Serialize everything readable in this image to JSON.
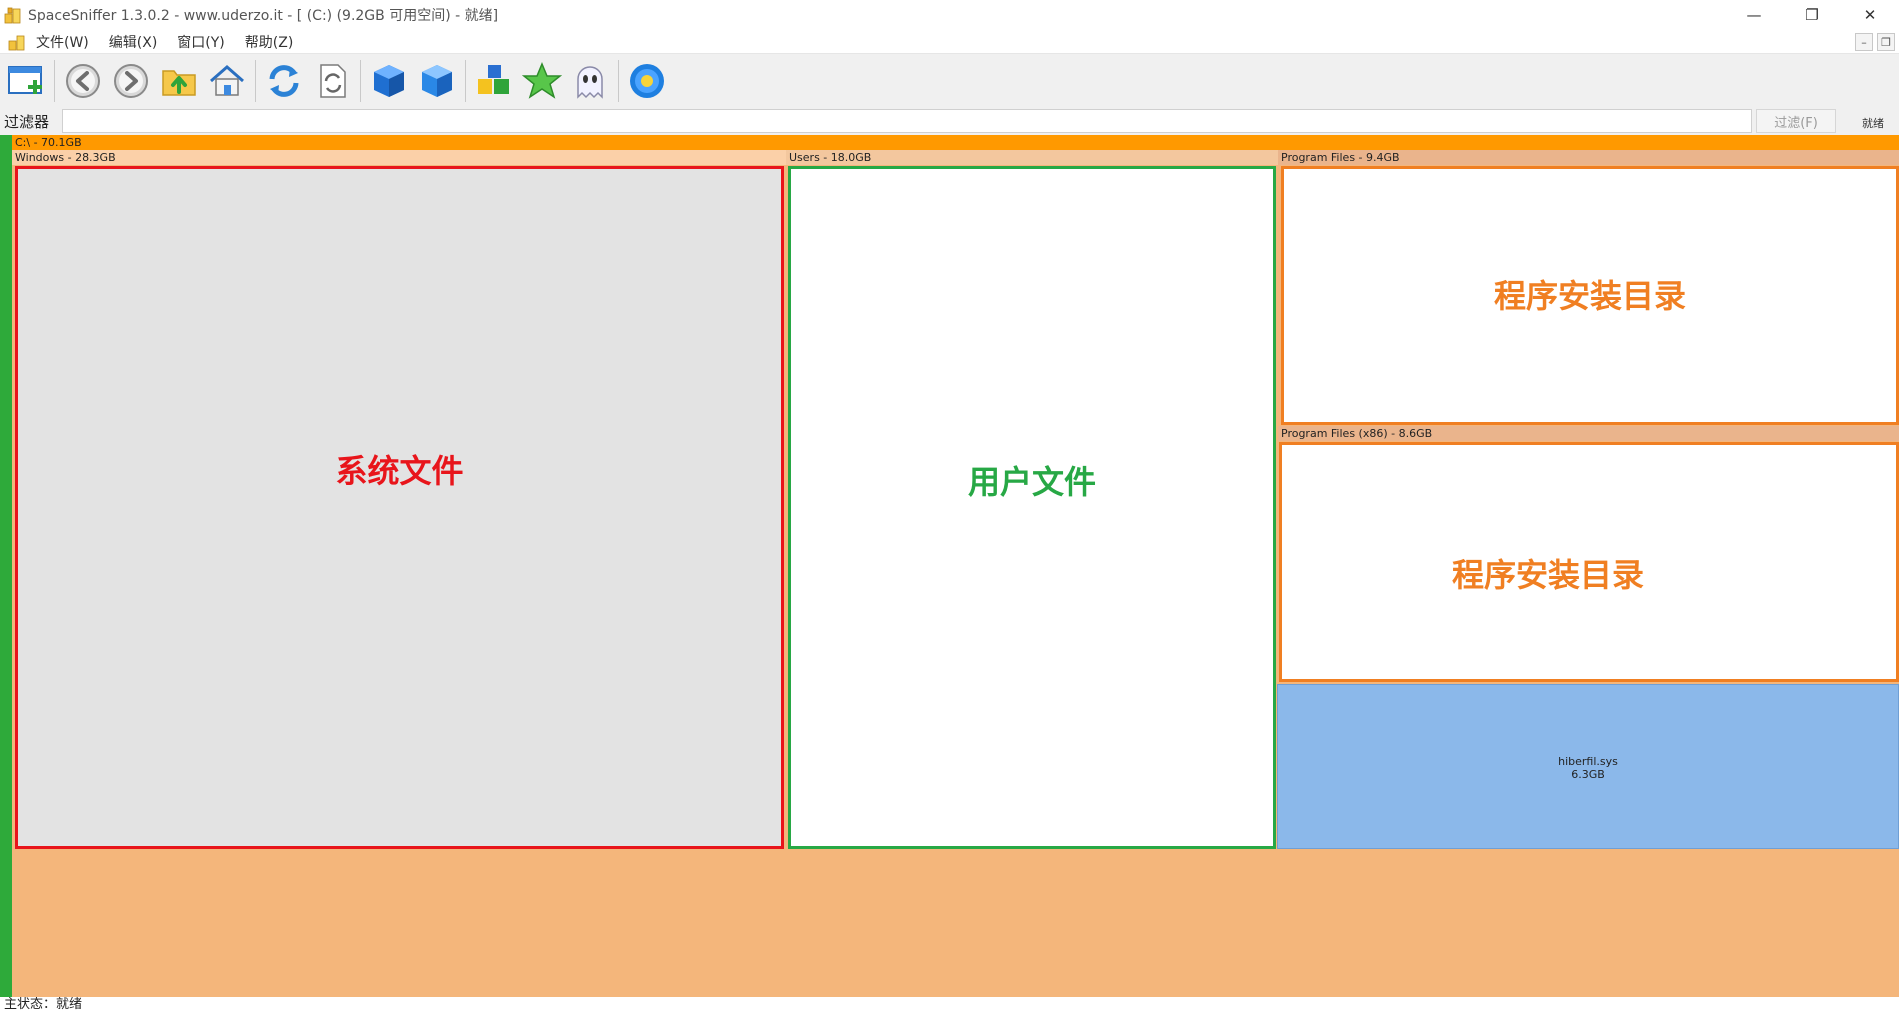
{
  "window": {
    "title": "SpaceSniffer 1.3.0.2 - www.uderzo.it - [ (C:) (9.2GB 可用空间) - 就绪]",
    "minimize": "—",
    "restore": "❐",
    "close": "✕"
  },
  "menu": {
    "items": [
      "文件(W)",
      "编辑(X)",
      "窗口(Y)",
      "帮助(Z)"
    ],
    "mdi_minimize": "–",
    "mdi_restore": "❐"
  },
  "toolbar": {
    "icons": [
      "new-scan-window-icon",
      "back-icon",
      "forward-icon",
      "parent-folder-icon",
      "home-icon",
      "refresh-icon",
      "refresh-file-icon",
      "blue-cube-icon",
      "blue-cube-alt-icon",
      "color-cubes-icon",
      "star-icon",
      "ghost-icon",
      "settings-flower-icon"
    ]
  },
  "filter": {
    "label": "过滤器",
    "value": "",
    "button": "过滤(F)",
    "status": "就绪"
  },
  "treemap": {
    "root": {
      "label": "C:\\ - 70.1GB",
      "color": "#ff9900"
    },
    "windows": {
      "label": "Windows - 28.3GB",
      "annotation": "系统文件",
      "frame_color": "#e8151b",
      "fill": "#e3e3e3"
    },
    "users": {
      "label": "Users - 18.0GB",
      "annotation": "用户文件",
      "frame_color": "#27a845",
      "fill": "#ffffff"
    },
    "program_files": {
      "label": "Program Files - 9.4GB",
      "annotation": "程序安装目录",
      "frame_color": "#f07f22",
      "fill": "#ffffff"
    },
    "program_files_x86": {
      "label": "Program Files (x86) - 8.6GB",
      "annotation": "程序安装目录",
      "frame_color": "#f07f22",
      "fill": "#ffffff"
    },
    "hiberfil": {
      "name": "hiberfil.sys",
      "size": "6.3GB",
      "color": "#8bb8ea"
    }
  },
  "status": {
    "text": "主状态：就绪"
  }
}
